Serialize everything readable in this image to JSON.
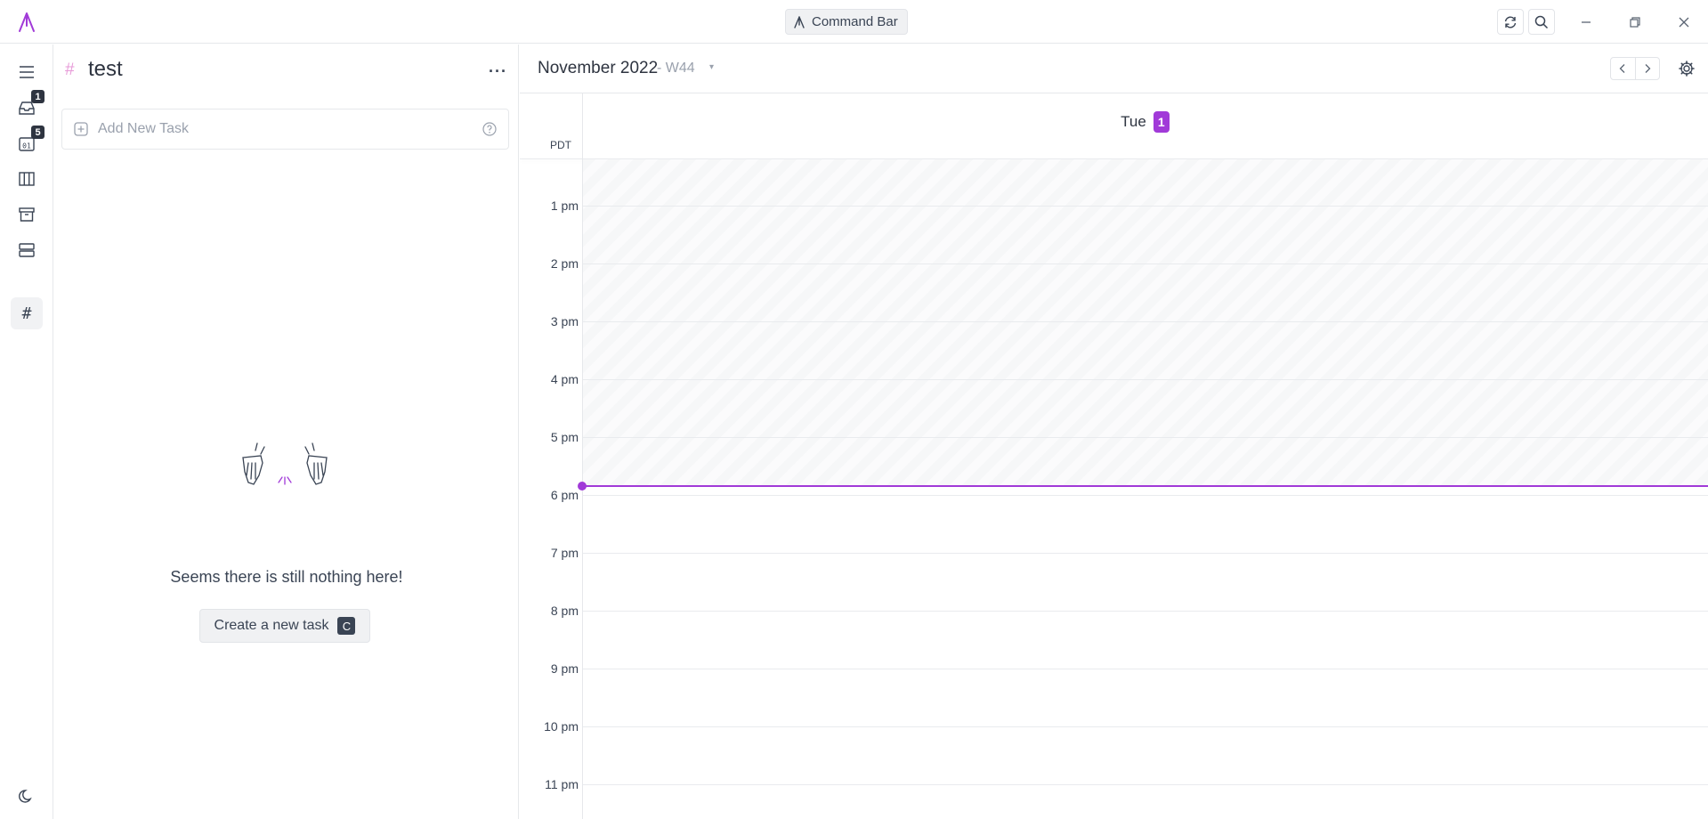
{
  "app": {
    "command_bar_label": "Command Bar"
  },
  "rail": {
    "inbox_badge": "1",
    "today_badge": "5",
    "today_icon_text": "01",
    "channel_glyph": "#"
  },
  "list": {
    "hash": "#",
    "title": "test",
    "more": "···",
    "add_task_placeholder": "Add New Task",
    "empty_message": "Seems there is still nothing here!",
    "create_button_label": "Create a new task",
    "create_shortcut": "C"
  },
  "calendar": {
    "month": "November 2022",
    "week": "- W44",
    "week_caret": "▾",
    "day_name": "Tue",
    "day_number": "1",
    "timezone": "PDT",
    "hours": [
      "1 pm",
      "2 pm",
      "3 pm",
      "4 pm",
      "5 pm",
      "6 pm",
      "7 pm",
      "8 pm",
      "9 pm",
      "10 pm",
      "11 pm"
    ],
    "accent_color": "#a13ad8"
  }
}
